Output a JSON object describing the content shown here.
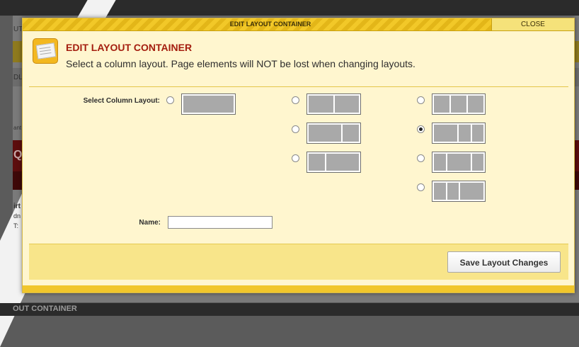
{
  "background": {
    "fragments": [
      "UT",
      "DL",
      "Qu",
      "ant",
      "irt",
      "dn",
      "T:"
    ],
    "bottom_label": "OUT CONTAINER"
  },
  "dialog": {
    "titlebar": "EDIT LAYOUT CONTAINER",
    "close_label": "CLOSE",
    "header_icon": "layout-document-icon",
    "header_title": "EDIT LAYOUT CONTAINER",
    "header_subtitle": "Select a column layout. Page elements will NOT be lost when changing layouts.",
    "select_label": "Select Column Layout:",
    "name_label": "Name:",
    "name_value": "",
    "save_label": "Save Layout Changes",
    "selected_layout": "three-column-wide-left",
    "layouts": [
      {
        "id": "one-column",
        "columns": [
          1
        ]
      },
      {
        "id": "two-column-even",
        "columns": [
          1,
          1
        ]
      },
      {
        "id": "two-column-wide-left",
        "columns": [
          2,
          1
        ]
      },
      {
        "id": "two-column-wide-right",
        "columns": [
          1,
          2
        ]
      },
      {
        "id": "three-column-even",
        "columns": [
          1,
          1,
          1
        ]
      },
      {
        "id": "three-column-wide-left",
        "columns": [
          2,
          1,
          1
        ]
      },
      {
        "id": "three-column-wide-center",
        "columns": [
          1,
          2,
          1
        ]
      },
      {
        "id": "three-column-wide-right",
        "columns": [
          1,
          1,
          2
        ]
      }
    ]
  },
  "colors": {
    "dialog_bg": "#fff6cf",
    "title_stripe": "#f2c828",
    "header_title": "#a41e0f",
    "footer_bg": "#f8e58a"
  }
}
